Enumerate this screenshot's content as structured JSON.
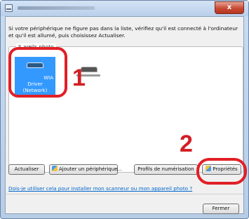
{
  "window": {
    "close_label": "x"
  },
  "dialog": {
    "instruction": "Si votre périphérique ne figure pas dans la liste, vérifiez qu'il est connecté à l'ordinateur et qu'il est allumé, puis choisissez Actualiser.",
    "group_label": "S          areils photo",
    "devices": [
      {
        "label": "WIA\nDriver (Network)",
        "selected": true
      },
      {
        "label": "",
        "selected": false
      }
    ],
    "buttons": {
      "refresh": "Actualiser",
      "add_device": "Ajouter un périphérique...",
      "scan_profiles": "Profils de numérisation",
      "properties": "Propriétés",
      "close": "Fermer"
    },
    "help_link": "Dois-je utiliser cela pour installer mon scanneur ou mon appareil photo ?"
  },
  "annotations": {
    "step1": "1",
    "step2": "2",
    "highlight_color": "#e21f26"
  }
}
